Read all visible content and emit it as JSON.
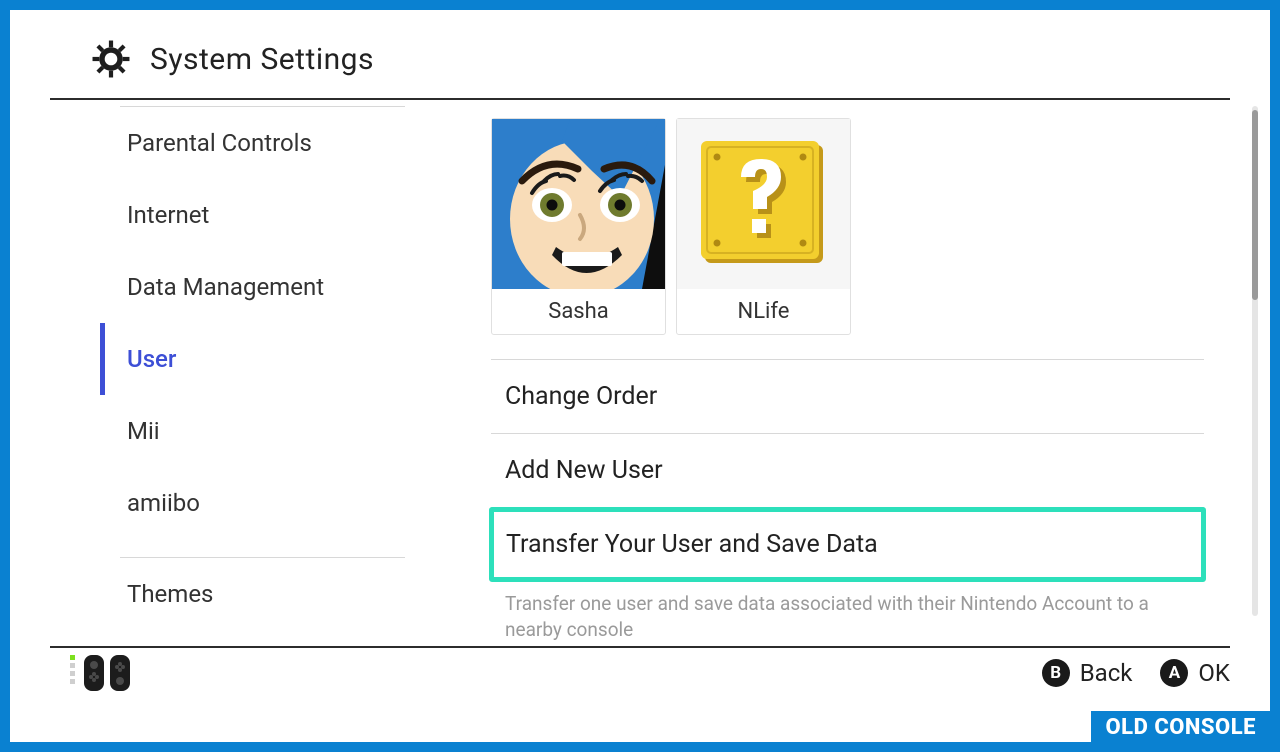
{
  "header": {
    "title": "System Settings"
  },
  "sidebar": {
    "items": [
      {
        "label": "Parental Controls",
        "selected": false
      },
      {
        "label": "Internet",
        "selected": false
      },
      {
        "label": "Data Management",
        "selected": false
      },
      {
        "label": "User",
        "selected": true
      },
      {
        "label": "Mii",
        "selected": false
      },
      {
        "label": "amiibo",
        "selected": false
      }
    ],
    "after_divider": {
      "label": "Themes"
    }
  },
  "users": [
    {
      "name": "Sasha",
      "avatar_kind": "mii-face"
    },
    {
      "name": "NLife",
      "avatar_kind": "question-block"
    }
  ],
  "options": [
    {
      "label": "Change Order"
    },
    {
      "label": "Add New User"
    },
    {
      "label": "Transfer Your User and Save Data",
      "highlighted": true
    }
  ],
  "option_description": "Transfer one user and save data associated with their Nintendo Account to a nearby console",
  "footer": {
    "hints": [
      {
        "button": "B",
        "label": "Back"
      },
      {
        "button": "A",
        "label": "OK"
      }
    ]
  },
  "banner": "OLD CONSOLE",
  "colors": {
    "frame": "#0a81d1",
    "highlight": "#2de0bb",
    "selected": "#3d4fd6"
  }
}
